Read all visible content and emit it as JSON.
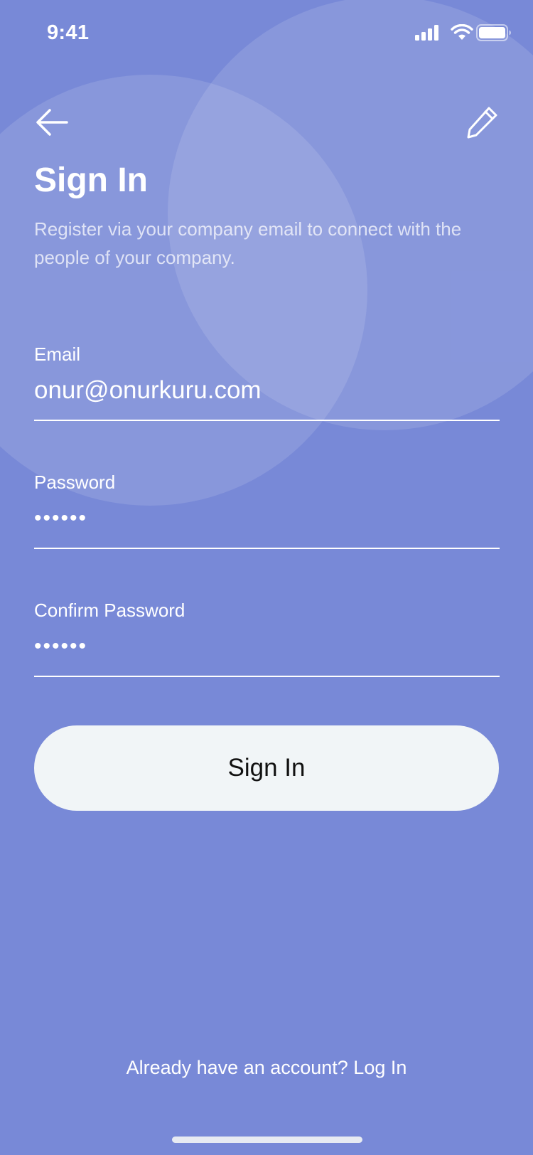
{
  "status_bar": {
    "time": "9:41",
    "icons": [
      "signal-icon",
      "wifi-icon",
      "battery-icon"
    ]
  },
  "header": {
    "back_icon": "arrow-left-icon",
    "edit_icon": "pencil-icon"
  },
  "page": {
    "title": "Sign In",
    "subtitle": "Register via your company email to connect with the people of your company."
  },
  "form": {
    "email": {
      "label": "Email",
      "value": "onur@onurkuru.com"
    },
    "password": {
      "label": "Password",
      "value": "••••••"
    },
    "confirm_password": {
      "label": "Confirm Password",
      "value": "••••••"
    },
    "submit_label": "Sign In"
  },
  "footer": {
    "link_text": "Already have an account? Log In"
  },
  "colors": {
    "background": "#7889d7",
    "button_background": "#f1f5f7",
    "text": "#ffffff"
  }
}
